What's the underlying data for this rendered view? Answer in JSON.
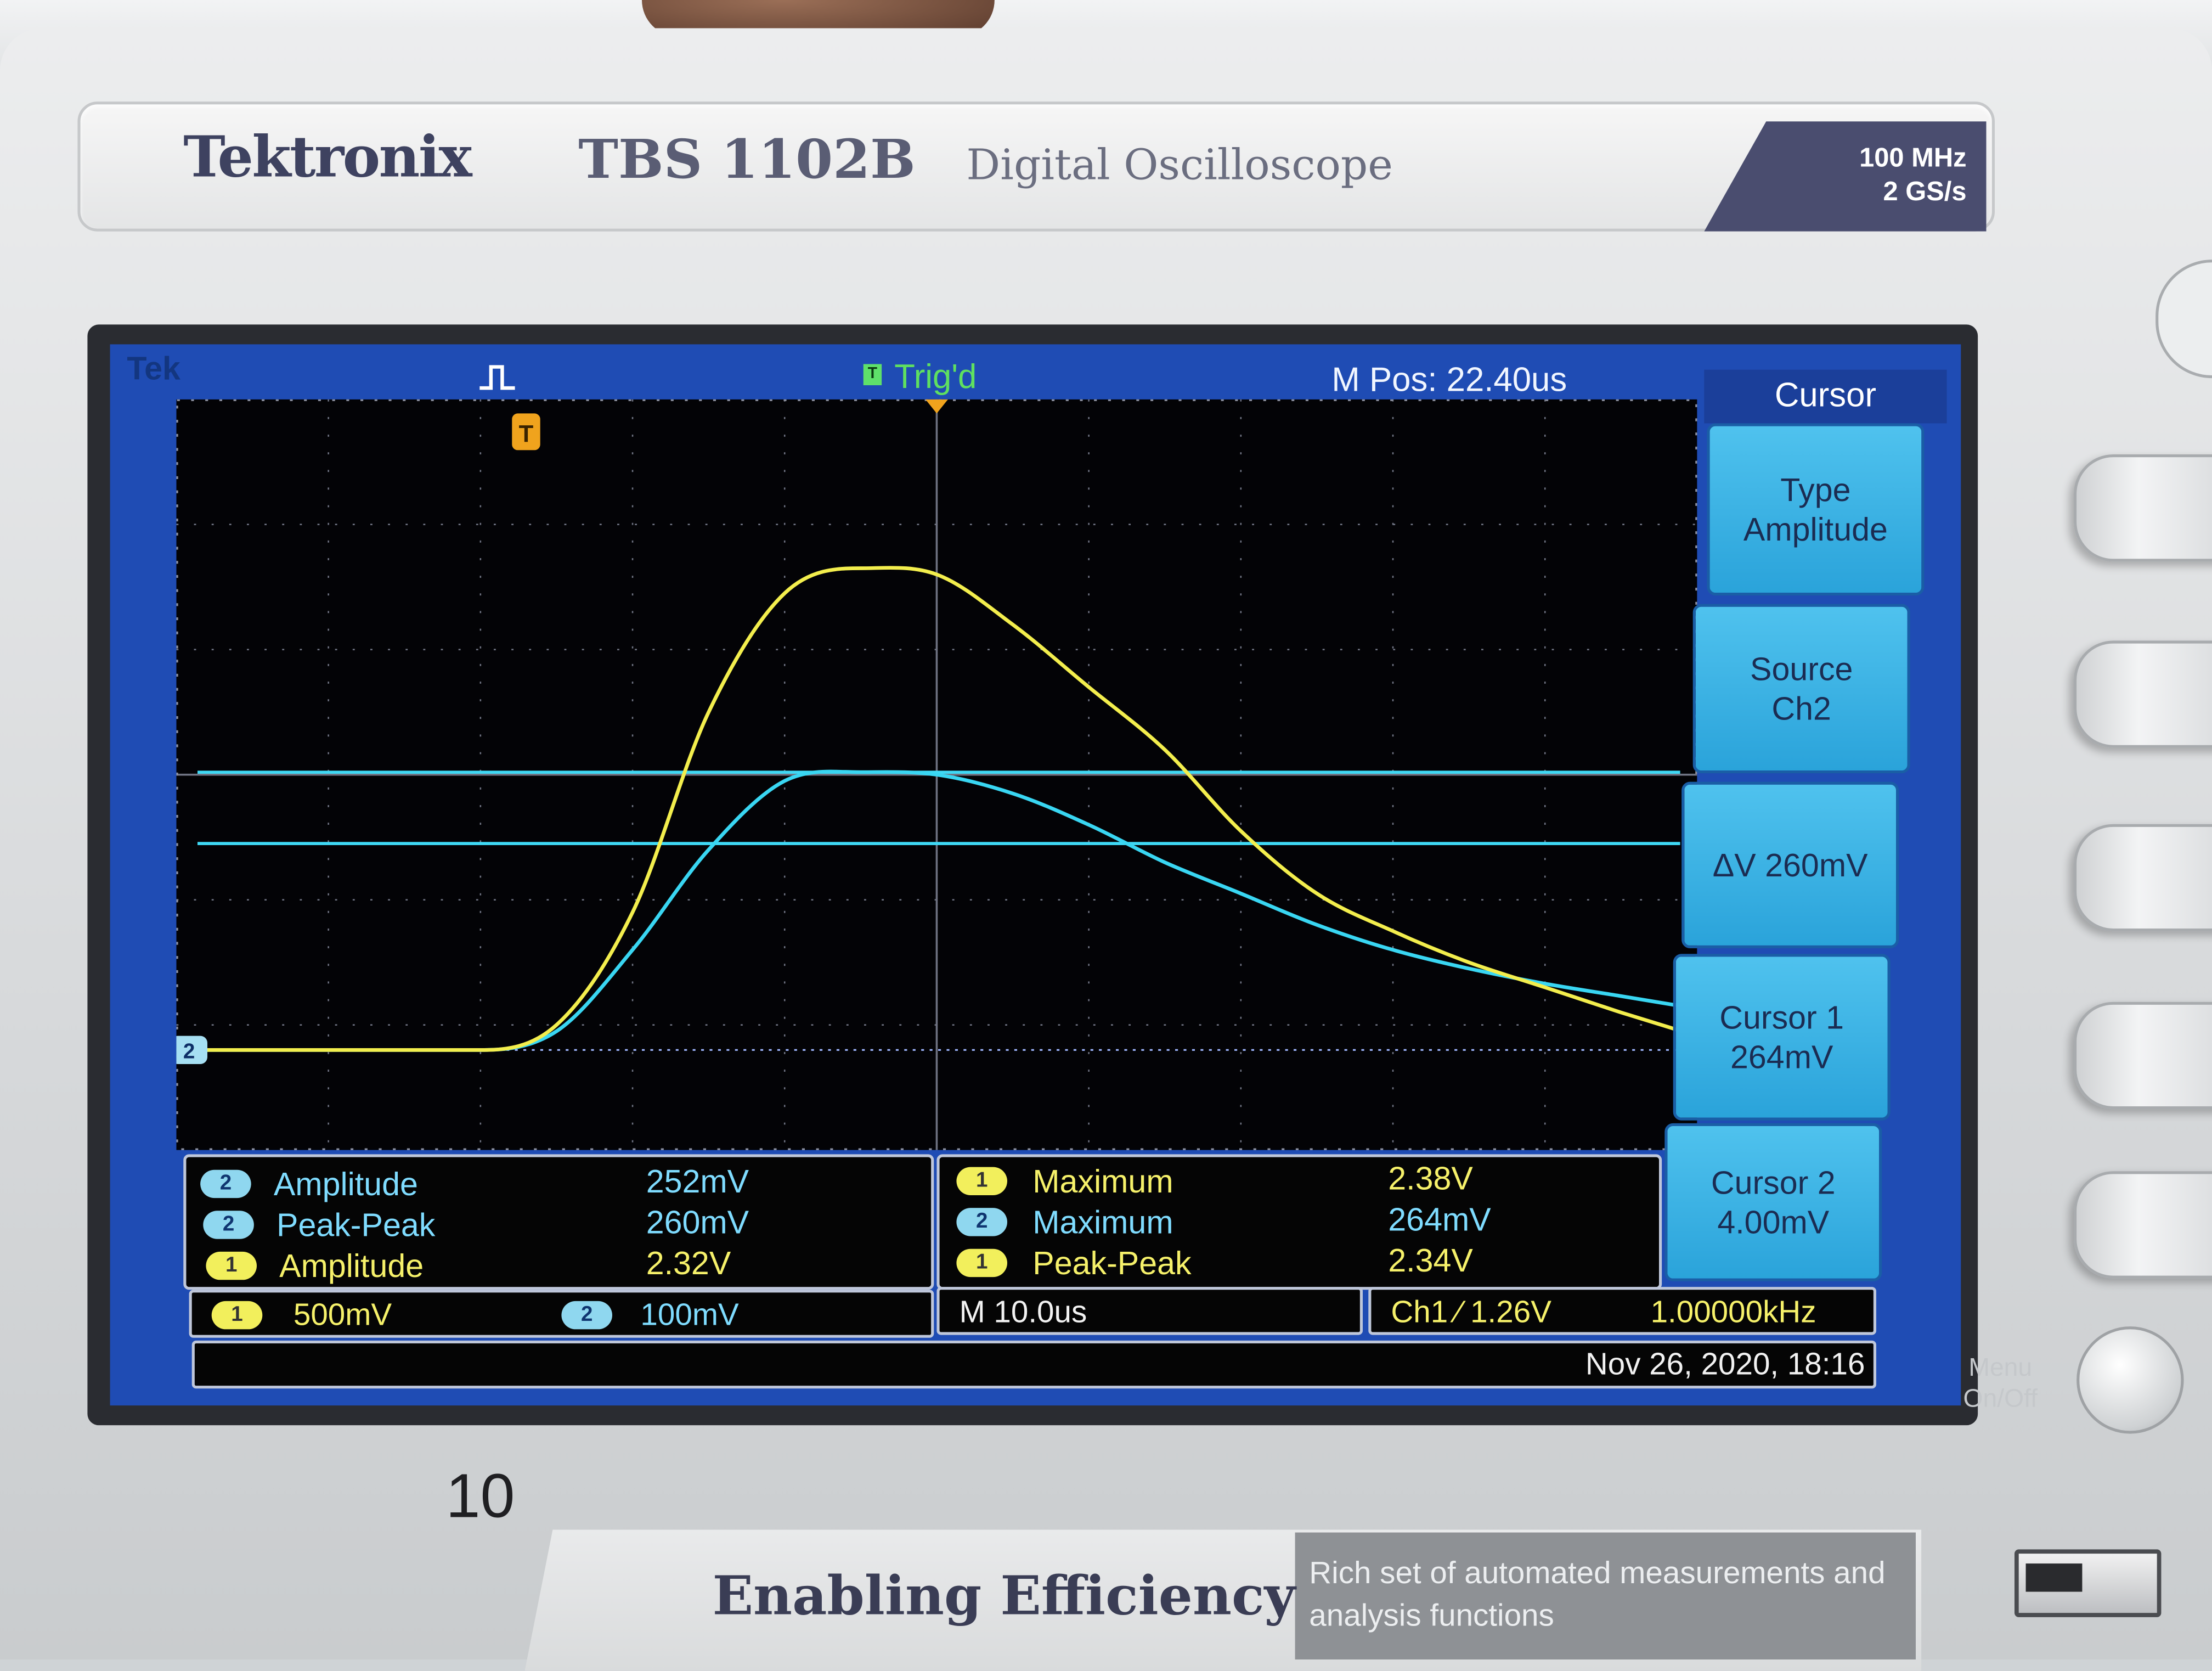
{
  "device": {
    "brand": "Tektronix",
    "model": "TBS 1102B",
    "description": "Digital Oscilloscope",
    "bandwidth": "100 MHz",
    "sample_rate": "2 GS/s",
    "slogan": "Enabling Efficiency",
    "feature_text": "Rich set of automated measurements and analysis functions",
    "page_number": "10",
    "menu_button_label": [
      "Menu",
      "On/Off"
    ]
  },
  "status": {
    "logo": "Tek",
    "trigger_state": "Trig'd",
    "trigger_badge": "T",
    "m_pos": "M Pos: 22.40us"
  },
  "markers": {
    "trigger_point": "T",
    "ch2_ground": "2"
  },
  "cursor_menu": {
    "title": "Cursor",
    "items": [
      {
        "line1": "Type",
        "line2": "Amplitude"
      },
      {
        "line1": "Source",
        "line2": "Ch2"
      },
      {
        "line1": "ΔV 260mV",
        "line2": ""
      },
      {
        "line1": "Cursor 1",
        "line2": "264mV"
      },
      {
        "line1": "Cursor 2",
        "line2": "4.00mV"
      }
    ]
  },
  "measurements": {
    "left": [
      {
        "ch": "2",
        "label": "Amplitude",
        "value": "252mV"
      },
      {
        "ch": "2",
        "label": "Peak-Peak",
        "value": "260mV"
      },
      {
        "ch": "1",
        "label": "Amplitude",
        "value": "2.32V"
      }
    ],
    "right": [
      {
        "ch": "1",
        "label": "Maximum",
        "value": "2.38V"
      },
      {
        "ch": "2",
        "label": "Maximum",
        "value": "264mV"
      },
      {
        "ch": "1",
        "label": "Peak-Peak",
        "value": "2.34V"
      }
    ]
  },
  "settings": {
    "ch1_num": "1",
    "ch1_scale": "500mV",
    "ch2_num": "2",
    "ch2_scale": "100mV",
    "timebase": "M 10.0us",
    "trigger": "Ch1 ⁄ 1.26V",
    "frequency": "1.00000kHz",
    "datetime": "Nov 26, 2020, 18:16"
  },
  "colors": {
    "ch1": "#f3ee4d",
    "ch2": "#39d6f2",
    "screen_bg": "#000000",
    "frame_blue": "#1f4cb4"
  },
  "chart_data": {
    "type": "line",
    "title": "",
    "xlabel": "",
    "ylabel": "",
    "x_unit": "div",
    "y_unit": "div",
    "xlim": [
      0,
      10
    ],
    "ylim": [
      0,
      6
    ],
    "grid": true,
    "series": [
      {
        "name": "",
        "channel": "1",
        "color": "#f3ee4d",
        "x": [
          0,
          1.0,
          1.5,
          2.0,
          2.5,
          3.0,
          3.5,
          4.0,
          4.5,
          5.0,
          5.5,
          6.0,
          6.5,
          7.0,
          7.5,
          8.0,
          8.5,
          9.0,
          9.5,
          9.9
        ],
        "y": [
          0.8,
          0.8,
          0.8,
          0.8,
          1.0,
          1.9,
          3.5,
          4.45,
          4.65,
          4.6,
          4.2,
          3.7,
          3.2,
          2.55,
          2.05,
          1.75,
          1.5,
          1.3,
          1.1,
          0.95
        ]
      },
      {
        "name": "",
        "channel": "2",
        "color": "#39d6f2",
        "x": [
          0,
          1.0,
          1.5,
          2.0,
          2.5,
          3.0,
          3.5,
          4.0,
          4.5,
          5.0,
          5.5,
          6.0,
          6.5,
          7.0,
          7.5,
          8.0,
          8.5,
          9.0,
          9.5,
          9.9
        ],
        "y": [
          0.8,
          0.8,
          0.8,
          0.8,
          0.95,
          1.6,
          2.4,
          2.95,
          3.02,
          3.0,
          2.85,
          2.6,
          2.3,
          2.05,
          1.8,
          1.6,
          1.45,
          1.33,
          1.23,
          1.15
        ]
      }
    ],
    "cursors": [
      {
        "name": "Cursor 1",
        "value": "264mV",
        "y_div": 3.02
      },
      {
        "name": "Cursor 2",
        "value": "4.00mV",
        "y_div": 2.45
      }
    ],
    "ground_level_div": 0.8
  }
}
